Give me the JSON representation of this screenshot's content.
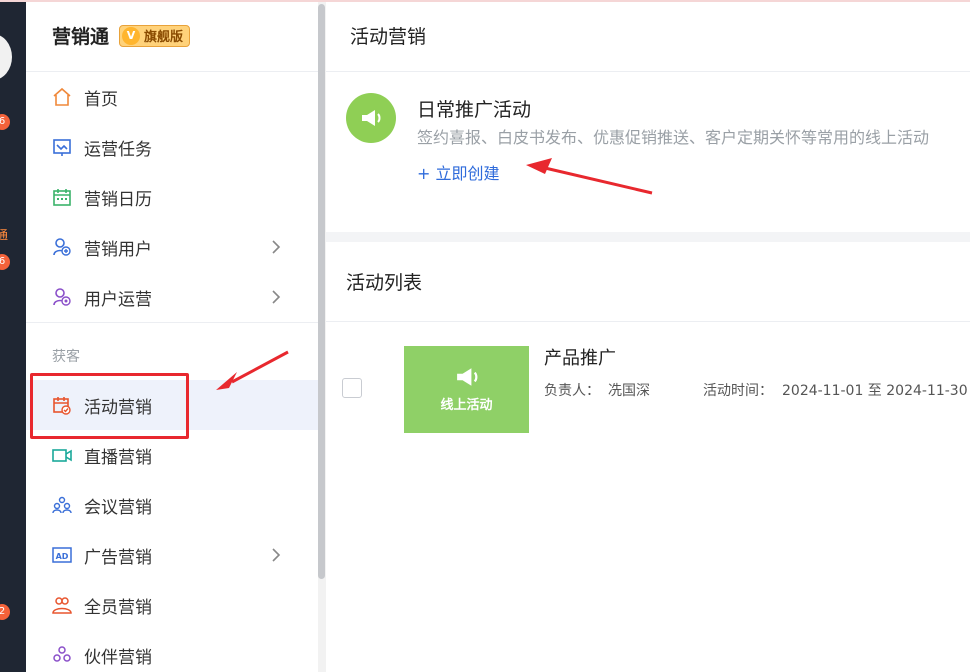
{
  "rail": {
    "badges": [
      "6",
      "6",
      "2"
    ],
    "snippets": [
      "通"
    ]
  },
  "sidebar": {
    "brand": "营销通",
    "edition": "旗舰版",
    "edition_mark": "V",
    "section_label": "获客",
    "items": [
      {
        "label": "首页",
        "icon": "home-icon",
        "chevron": false
      },
      {
        "label": "运营任务",
        "icon": "task-icon",
        "chevron": false
      },
      {
        "label": "营销日历",
        "icon": "calendar-icon",
        "chevron": false
      },
      {
        "label": "营销用户",
        "icon": "user-add-icon",
        "chevron": true
      },
      {
        "label": "用户运营",
        "icon": "user-ops-icon",
        "chevron": true
      },
      {
        "label": "活动营销",
        "icon": "activity-calendar-icon",
        "chevron": false,
        "active": true
      },
      {
        "label": "直播营销",
        "icon": "video-icon",
        "chevron": false
      },
      {
        "label": "会议营销",
        "icon": "meeting-icon",
        "chevron": false
      },
      {
        "label": "广告营销",
        "icon": "ad-icon",
        "chevron": true
      },
      {
        "label": "全员营销",
        "icon": "team-icon",
        "chevron": false
      },
      {
        "label": "伙伴营销",
        "icon": "partner-icon",
        "chevron": false
      }
    ]
  },
  "main": {
    "header_title": "活动营销",
    "promo": {
      "title": "日常推广活动",
      "description": "签约喜报、白皮书发布、优惠促销推送、客户定期关怀等常用的线上活动",
      "create_link": "+ 立即创建"
    },
    "list": {
      "title": "活动列表",
      "items": [
        {
          "name": "产品推广",
          "thumb_label": "线上活动",
          "owner_label": "负责人：",
          "owner": "冼国深",
          "time_label": "活动时间：",
          "time": "2024-11-01 至 2024-11-30"
        }
      ]
    }
  },
  "colors": {
    "accent_blue": "#2f6bdb",
    "brand_green": "#8fcf55",
    "annotation_red": "#e8282e",
    "rail_dark": "#1f2633"
  }
}
